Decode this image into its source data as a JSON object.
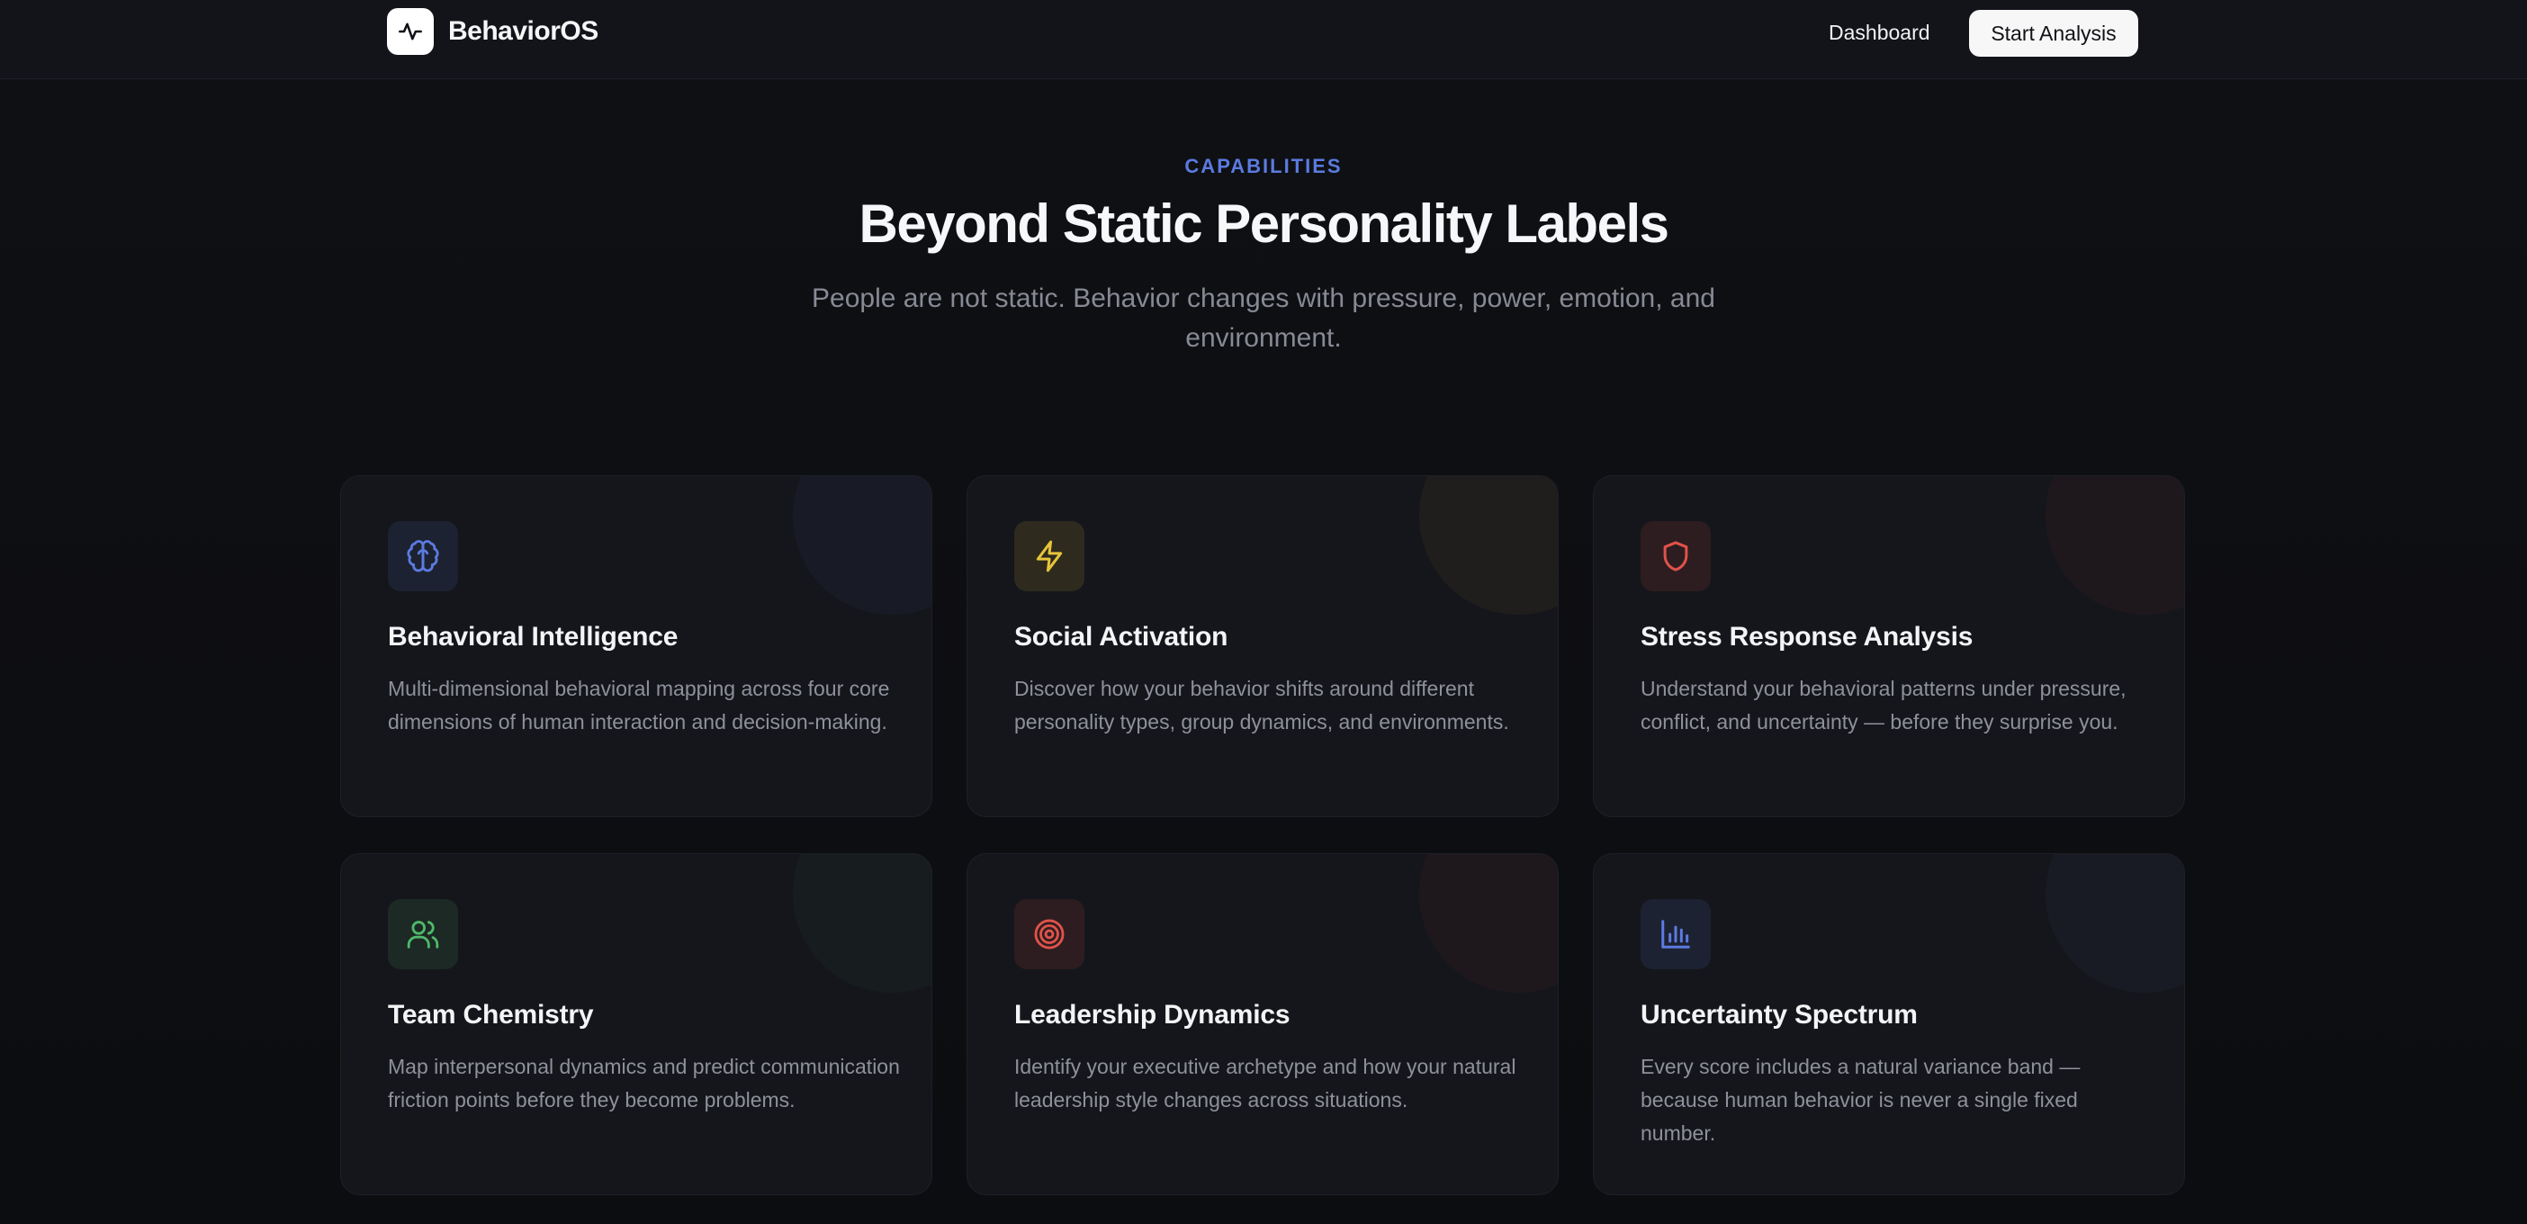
{
  "header": {
    "brand_name": "BehaviorOS",
    "brand_icon": "activity-icon",
    "nav_dashboard": "Dashboard",
    "nav_start": "Start Analysis"
  },
  "hero": {
    "eyebrow": "CAPABILITIES",
    "title": "Beyond Static Personality Labels",
    "subtitle": "People are not static. Behavior changes with pressure, power, emotion, and environment."
  },
  "colors": {
    "accent_blue": "#5b7be0",
    "yellow": "#e8c43a",
    "red": "#e0524a",
    "green": "#4fb86a"
  },
  "cards": [
    {
      "title": "Behavioral Intelligence",
      "description": "Multi-dimensional behavioral mapping across four core dimensions of human interaction and decision-making.",
      "icon": "brain-icon",
      "color": "#5b7be0"
    },
    {
      "title": "Social Activation",
      "description": "Discover how your behavior shifts around different personality types, group dynamics, and environments.",
      "icon": "lightning-icon",
      "color": "#e8c43a"
    },
    {
      "title": "Stress Response Analysis",
      "description": "Understand your behavioral patterns under pressure, conflict, and uncertainty — before they surprise you.",
      "icon": "shield-icon",
      "color": "#e0524a"
    },
    {
      "title": "Team Chemistry",
      "description": "Map interpersonal dynamics and predict communication friction points before they become problems.",
      "icon": "users-icon",
      "color": "#4fb86a"
    },
    {
      "title": "Leadership Dynamics",
      "description": "Identify your executive archetype and how your natural leadership style changes across situations.",
      "icon": "target-icon",
      "color": "#e0524a"
    },
    {
      "title": "Uncertainty Spectrum",
      "description": "Every score includes a natural variance band — because human behavior is never a single fixed number.",
      "icon": "bar-chart-icon",
      "color": "#5b7be0"
    }
  ]
}
